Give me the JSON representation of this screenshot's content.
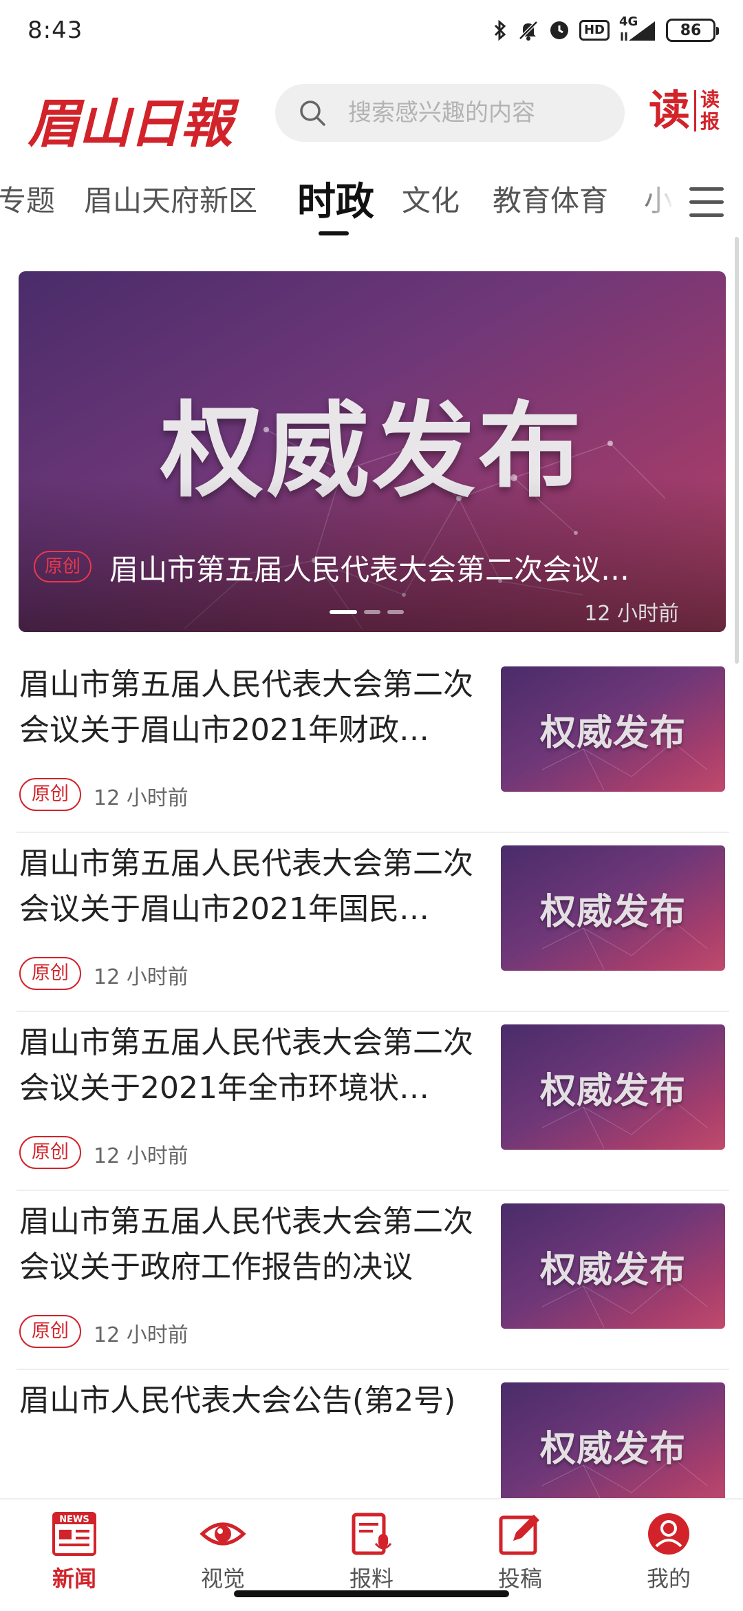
{
  "status_bar": {
    "time": "8:43",
    "network": "4G",
    "hd_label": "HD",
    "battery": "86",
    "icons": [
      "bluetooth-icon",
      "mute-icon",
      "alarm-icon",
      "hd-icon",
      "signal-icon",
      "battery-icon"
    ]
  },
  "header": {
    "logo_text": "眉山日報",
    "search_placeholder": "搜索感兴趣的内容",
    "read_big": "读",
    "read_small_top": "读",
    "read_small_bottom": "报"
  },
  "tabs": [
    {
      "label": "专题"
    },
    {
      "label": "眉山天府新区"
    },
    {
      "label": "时政",
      "active": true
    },
    {
      "label": "文化"
    },
    {
      "label": "教育体育"
    },
    {
      "label": "小"
    }
  ],
  "banner": {
    "headline": "权威发布",
    "tag": "原创",
    "title": "眉山市第五届人民代表大会第二次会议…",
    "time": "12 小时前",
    "slide_count": 3,
    "active_slide": 1
  },
  "news": [
    {
      "title": "眉山市第五届人民代表大会第二次会议关于眉山市2021年财政…",
      "tag": "原创",
      "time": "12 小时前",
      "thumb_text": "权威发布"
    },
    {
      "title": "眉山市第五届人民代表大会第二次会议关于眉山市2021年国民…",
      "tag": "原创",
      "time": "12 小时前",
      "thumb_text": "权威发布"
    },
    {
      "title": "眉山市第五届人民代表大会第二次会议关于2021年全市环境状…",
      "tag": "原创",
      "time": "12 小时前",
      "thumb_text": "权威发布"
    },
    {
      "title": "眉山市第五届人民代表大会第二次会议关于政府工作报告的决议",
      "tag": "原创",
      "time": "12 小时前",
      "thumb_text": "权威发布"
    },
    {
      "title": "眉山市人民代表大会公告(第2号)",
      "tag": "",
      "time": "",
      "thumb_text": "权威发布"
    }
  ],
  "bottom_nav": [
    {
      "label": "新闻",
      "icon": "newspaper-icon",
      "active": true
    },
    {
      "label": "视觉",
      "icon": "eye-icon"
    },
    {
      "label": "报料",
      "icon": "report-mic-icon"
    },
    {
      "label": "投稿",
      "icon": "edit-submit-icon"
    },
    {
      "label": "我的",
      "icon": "user-icon"
    }
  ],
  "colors": {
    "brand_red": "#d2232a",
    "banner_purple": "#6e3778",
    "text_dark": "#222222",
    "text_muted": "#666666"
  }
}
